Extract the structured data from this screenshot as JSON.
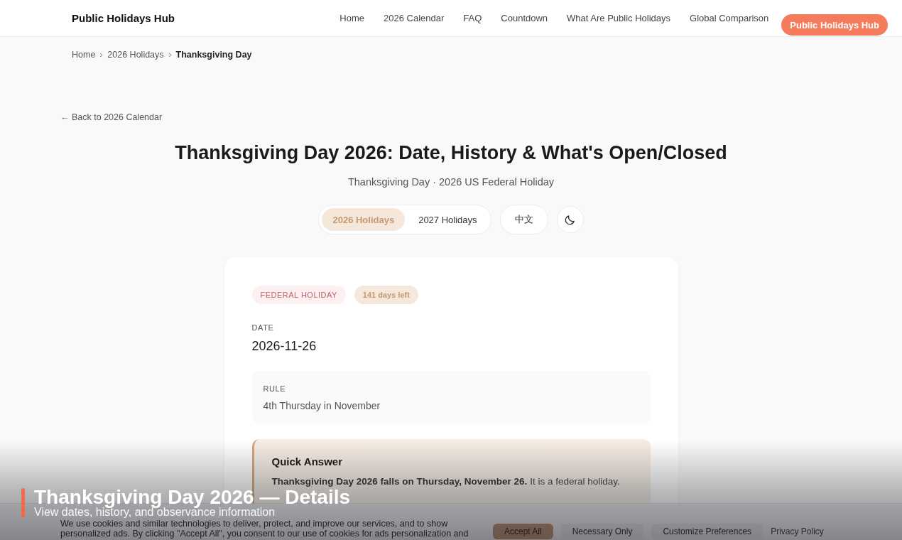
{
  "site": {
    "logo": "Public Holidays Hub",
    "nav": [
      {
        "label": "Home"
      },
      {
        "label": "2026 Calendar"
      },
      {
        "label": "FAQ"
      },
      {
        "label": "Countdown"
      },
      {
        "label": "What Are Public Holidays"
      },
      {
        "label": "Global Comparison"
      }
    ],
    "cta": "Public Holidays Hub"
  },
  "breadcrumb": [
    {
      "label": "Home",
      "current": false
    },
    {
      "label": "2026 Holidays",
      "current": false
    },
    {
      "label": "Thanksgiving Day",
      "current": true
    }
  ],
  "back_link": "← Back to 2026 Calendar",
  "title": "Thanksgiving Day 2026: Date, History & What's Open/Closed",
  "subtitle": "Thanksgiving Day · 2026 US Federal Holiday",
  "year_tabs": [
    {
      "label": "2026 Holidays",
      "selected": true
    },
    {
      "label": "2027 Holidays",
      "selected": false
    }
  ],
  "language_button": "中文",
  "card": {
    "badges": [
      {
        "kind": "type",
        "label": "FEDERAL HOLIDAY"
      },
      {
        "kind": "countdown",
        "label": "141 days left"
      }
    ],
    "date": {
      "label": "DATE",
      "value": "2026-11-26"
    },
    "rule": {
      "label": "RULE",
      "value": "4th Thursday in November"
    },
    "quick_answer": {
      "title": "Quick Answer",
      "text": "**Thanksgiving Day 2026 falls on Thursday, November 26.** It is a federal holiday."
    }
  },
  "cookie_banner": {
    "text": "We use cookies and similar technologies to deliver, protect, and improve our services, and to show personalized ads. By clicking \"Accept All\", you consent to our use of cookies for ads personalization and",
    "buttons": [
      {
        "kind": "primary",
        "label": "Accept All"
      },
      {
        "kind": "secondary",
        "label": "Necessary Only"
      },
      {
        "kind": "secondary",
        "label": "Customize Preferences"
      }
    ],
    "link": "Privacy Policy"
  },
  "caption": {
    "title": "Thanksgiving Day 2026 — Details",
    "subtitle": "View dates, history, and observance information"
  }
}
